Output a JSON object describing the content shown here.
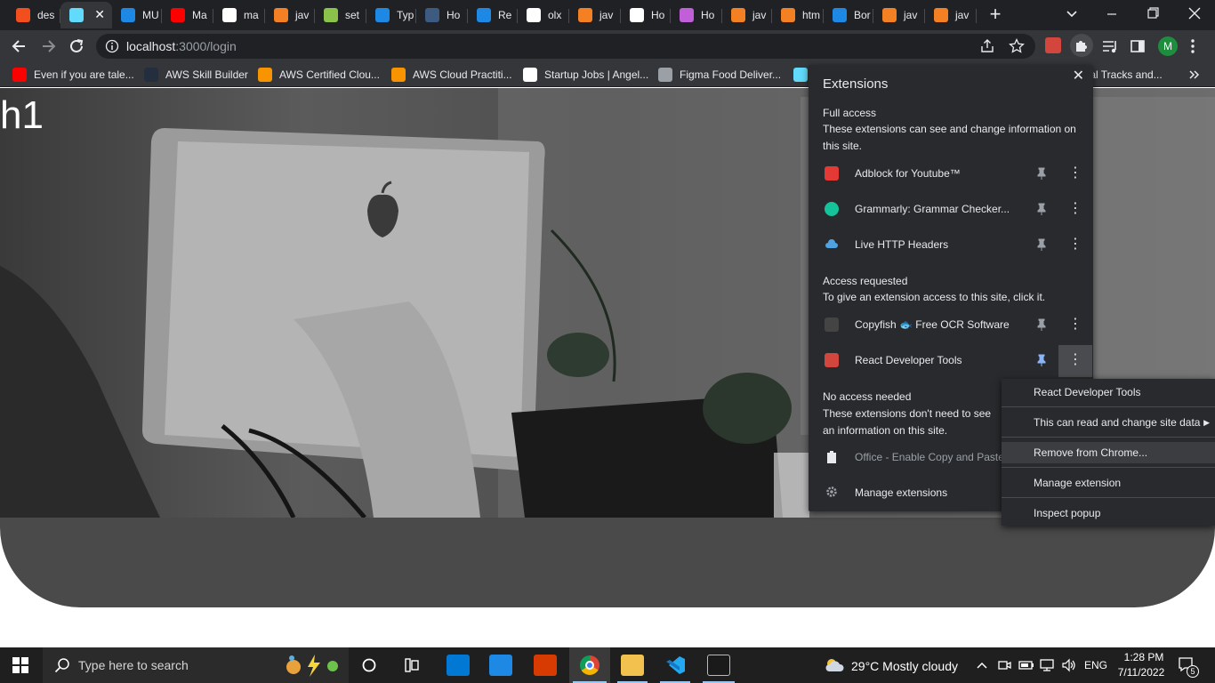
{
  "tabs": [
    {
      "label": "des",
      "icon": "figma-icon",
      "color": "#f24e1e"
    },
    {
      "label": "",
      "icon": "react-icon",
      "color": "#61dafb",
      "active": true
    },
    {
      "label": "MU",
      "icon": "mui-icon",
      "color": "#1e88e5"
    },
    {
      "label": "Ma",
      "icon": "youtube-icon",
      "color": "#ff0000"
    },
    {
      "label": "ma",
      "icon": "github-icon",
      "color": "#ffffff"
    },
    {
      "label": "jav",
      "icon": "stackoverflow-icon",
      "color": "#f48024"
    },
    {
      "label": "set",
      "icon": "set-icon",
      "color": "#8bc34a"
    },
    {
      "label": "Typ",
      "icon": "mui-icon",
      "color": "#1e88e5"
    },
    {
      "label": "Ho",
      "icon": "ub-icon",
      "color": "#3d5a80"
    },
    {
      "label": "Re",
      "icon": "mui-icon",
      "color": "#1e88e5"
    },
    {
      "label": "olx",
      "icon": "github-icon",
      "color": "#ffffff"
    },
    {
      "label": "jav",
      "icon": "stackoverflow-icon",
      "color": "#f48024"
    },
    {
      "label": "Ho",
      "icon": "github-icon",
      "color": "#ffffff"
    },
    {
      "label": "Ho",
      "icon": "m-icon",
      "color": "#c05fd8"
    },
    {
      "label": "jav",
      "icon": "stackoverflow-icon",
      "color": "#f48024"
    },
    {
      "label": "htm",
      "icon": "stackoverflow-icon",
      "color": "#f48024"
    },
    {
      "label": "Bor",
      "icon": "mui-icon",
      "color": "#1e88e5"
    },
    {
      "label": "jav",
      "icon": "stackoverflow-icon",
      "color": "#f48024"
    },
    {
      "label": "jav",
      "icon": "stackoverflow-icon",
      "color": "#f48024"
    }
  ],
  "address": {
    "host": "localhost",
    "rest": ":3000/login"
  },
  "bookmarks": [
    {
      "label": "Even if you are tale...",
      "icon": "youtube-icon",
      "color": "#ff0000"
    },
    {
      "label": "AWS Skill Builder",
      "icon": "aws-icon",
      "color": "#232f3e"
    },
    {
      "label": "AWS Certified Clou...",
      "icon": "aws-cube-icon",
      "color": "#f79400"
    },
    {
      "label": "AWS Cloud Practiti...",
      "icon": "aws-cube-icon",
      "color": "#f79400"
    },
    {
      "label": "Startup Jobs | Angel...",
      "icon": "angel-icon",
      "color": "#ffffff"
    },
    {
      "label": "Figma Food Deliver...",
      "icon": "globe-icon",
      "color": "#9aa0a6"
    },
    {
      "label": "",
      "icon": "react-icon",
      "color": "#61dafb"
    },
    {
      "label": "orial Tracks and...",
      "icon": "",
      "color": ""
    }
  ],
  "page": {
    "heading": "h1"
  },
  "extensions": {
    "title": "Extensions",
    "full_access": {
      "title": "Full access",
      "desc": "These extensions can see and change information on this site.",
      "items": [
        {
          "name": "Adblock for Youtube™",
          "color": "#e53935"
        },
        {
          "name": "Grammarly: Grammar Checker...",
          "color": "#15c39a"
        },
        {
          "name": "Live HTTP Headers",
          "color": "#4fa3e0"
        }
      ]
    },
    "access_requested": {
      "title": "Access requested",
      "desc": "To give an extension access to this site, click it.",
      "items": [
        {
          "name": "Copyfish 🐟 Free OCR Software",
          "color": "#444444"
        },
        {
          "name": "React Developer Tools",
          "color": "#d2463e"
        }
      ]
    },
    "no_access": {
      "title": "No access needed",
      "desc": "These extensions don't need to see an information on this site.",
      "items": [
        {
          "name": "Office - Enable Copy and Paste",
          "color": "#ffffff"
        }
      ]
    },
    "manage": "Manage extensions"
  },
  "context_menu": {
    "header": "React Developer Tools",
    "site_data": "This can read and change site data",
    "remove": "Remove from Chrome...",
    "manage": "Manage extension",
    "inspect": "Inspect popup"
  },
  "taskbar": {
    "search_placeholder": "Type here to search",
    "weather": "29°C  Mostly cloudy",
    "lang": "ENG",
    "time": "1:28 PM",
    "date": "7/11/2022",
    "notifications": "5"
  },
  "profile_initial": "M"
}
